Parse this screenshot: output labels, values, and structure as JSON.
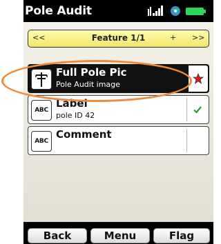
{
  "app": {
    "title": "Pole Audit"
  },
  "status_bar": {
    "icons": [
      "signal-icon",
      "gps-icon",
      "battery-icon"
    ],
    "battery_color": "#2fd55a"
  },
  "feature_nav": {
    "first_label": "<<",
    "title": "Feature 1/1",
    "add_label": "+",
    "next_label": ">>"
  },
  "fields": [
    {
      "title": "Full Pole Pic",
      "subtitle": "Pole Audit image",
      "icon": "pole-icon",
      "status": "required-star-icon",
      "selected": true
    },
    {
      "title": "Label",
      "subtitle": "pole ID 42",
      "icon": "abc-text-icon",
      "icon_text": "ABC",
      "status": "check-icon",
      "selected": false
    },
    {
      "title": "Comment",
      "subtitle": "",
      "icon": "abc-text-icon",
      "icon_text": "ABC",
      "status": "",
      "selected": false
    }
  ],
  "softkeys": {
    "back": "Back",
    "menu": "Menu",
    "flag": "Flag"
  },
  "colors": {
    "highlight": "#f08a3a",
    "nav_bar": "#f2e76a",
    "star": "#e0141e",
    "check": "#2a9a3a"
  }
}
